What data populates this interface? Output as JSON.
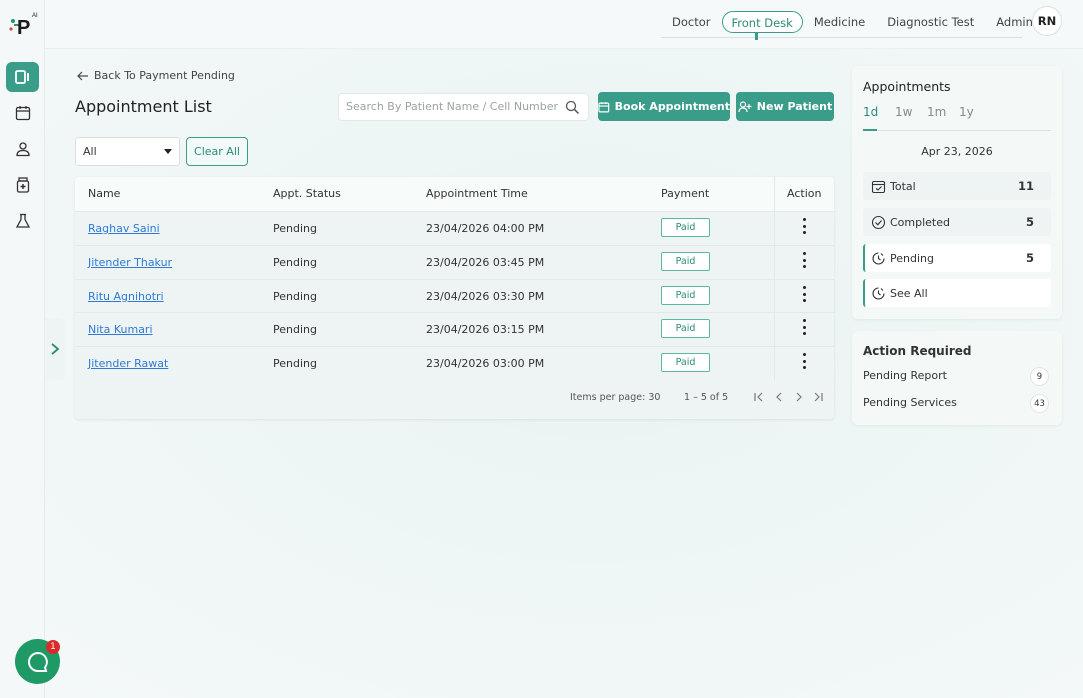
{
  "app": {
    "logo_text": "P",
    "logo_superscript": "AI"
  },
  "rail": {
    "items": [
      {
        "icon": "dashboard-icon",
        "active": true
      },
      {
        "icon": "calendar-icon",
        "active": false
      },
      {
        "icon": "user-icon",
        "active": false
      },
      {
        "icon": "medicine-icon",
        "active": false
      },
      {
        "icon": "flask-icon",
        "active": false
      }
    ]
  },
  "nav": {
    "items": [
      "Doctor",
      "Front Desk",
      "Medicine",
      "Diagnostic Test",
      "Admin"
    ],
    "active": "Front Desk",
    "avatar": "RN"
  },
  "page": {
    "back_label": "Back To Payment Pending",
    "title": "Appointment List",
    "search_placeholder": "Search By Patient Name / Cell Number",
    "book_label": "Book Appointment",
    "new_patient_label": "New Patient",
    "filter_value": "All",
    "clear_label": "Clear All"
  },
  "table": {
    "headers": [
      "Name",
      "Appt. Status",
      "Appointment Time",
      "Payment",
      "Action"
    ],
    "rows": [
      {
        "name": "Raghav Saini",
        "status": "Pending",
        "time": "23/04/2026 04:00 PM",
        "payment": "Paid"
      },
      {
        "name": "Jitender Thakur",
        "status": "Pending",
        "time": "23/04/2026 03:45 PM",
        "payment": "Paid"
      },
      {
        "name": "Ritu Agnihotri",
        "status": "Pending",
        "time": "23/04/2026 03:30 PM",
        "payment": "Paid"
      },
      {
        "name": "Nita Kumari",
        "status": "Pending",
        "time": "23/04/2026 03:15 PM",
        "payment": "Paid"
      },
      {
        "name": "Jitender Rawat",
        "status": "Pending",
        "time": "23/04/2026 03:00 PM",
        "payment": "Paid"
      }
    ],
    "items_per_page_label": "Items per page: 30",
    "range_label": "1 – 5 of 5"
  },
  "stats": {
    "title": "Appointments",
    "tabs": [
      "1d",
      "1w",
      "1m",
      "1y"
    ],
    "active_tab": "1d",
    "date": "Apr 23, 2026",
    "items": [
      {
        "label": "Total",
        "value": "11",
        "icon": "calendar-check-icon"
      },
      {
        "label": "Completed",
        "value": "5",
        "icon": "check-circle-icon"
      },
      {
        "label": "Pending",
        "value": "5",
        "icon": "clock-icon"
      },
      {
        "label": "See All",
        "value": "",
        "icon": "clock-icon"
      }
    ]
  },
  "action_required": {
    "title": "Action Required",
    "items": [
      {
        "label": "Pending Report",
        "count": "9"
      },
      {
        "label": "Pending Services",
        "count": "43"
      }
    ]
  },
  "chat": {
    "badge": "1"
  },
  "colors": {
    "accent": "#3a9d8a",
    "link": "#2f7ad6",
    "badge": "#d92b2b"
  }
}
